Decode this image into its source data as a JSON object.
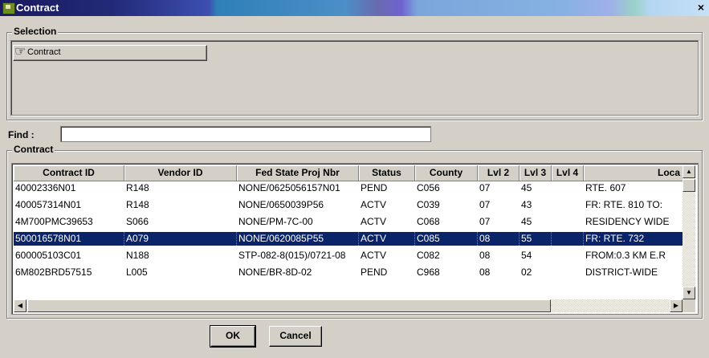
{
  "window": {
    "title": "Contract",
    "close_glyph": "×"
  },
  "selection": {
    "legend": "Selection",
    "button_label": "Contract",
    "button_icon": "pointing-hand-icon"
  },
  "find": {
    "label": "Find :",
    "value": ""
  },
  "contract_group": {
    "legend": "Contract",
    "columns": [
      "Contract ID",
      "Vendor ID",
      "Fed State Proj Nbr",
      "Status",
      "County",
      "Lvl 2",
      "Lvl 3",
      "Lvl 4",
      "Loca"
    ],
    "rows": [
      [
        "40002336N01",
        "R148",
        "NONE/0625056157N01",
        "PEND",
        "C056",
        "07",
        "45",
        "",
        "RTE. 607"
      ],
      [
        "400057314N01",
        "R148",
        "NONE/0650039P56",
        "ACTV",
        "C039",
        "07",
        "43",
        "",
        "FR: RTE. 810  TO:"
      ],
      [
        "4M700PMC39653",
        "S066",
        "NONE/PM-7C-00",
        "ACTV",
        "C068",
        "07",
        "45",
        "",
        "RESIDENCY WIDE"
      ],
      [
        "500016578N01",
        "A079",
        "NONE/0620085P55",
        "ACTV",
        "C085",
        "08",
        "55",
        "",
        "FR: RTE. 732"
      ],
      [
        "600005103C01",
        "N188",
        "STP-082-8(015)/0721-08",
        "ACTV",
        "C082",
        "08",
        "54",
        "",
        "FROM:0.3 KM E.R"
      ],
      [
        "6M802BRD57515",
        "L005",
        "NONE/BR-8D-02",
        "PEND",
        "C968",
        "08",
        "02",
        "",
        "DISTRICT-WIDE"
      ]
    ],
    "selected_row": 3
  },
  "buttons": {
    "ok": "OK",
    "cancel": "Cancel"
  },
  "colors": {
    "selection_bg": "#0a246a",
    "window_bg": "#d4d0c8"
  }
}
